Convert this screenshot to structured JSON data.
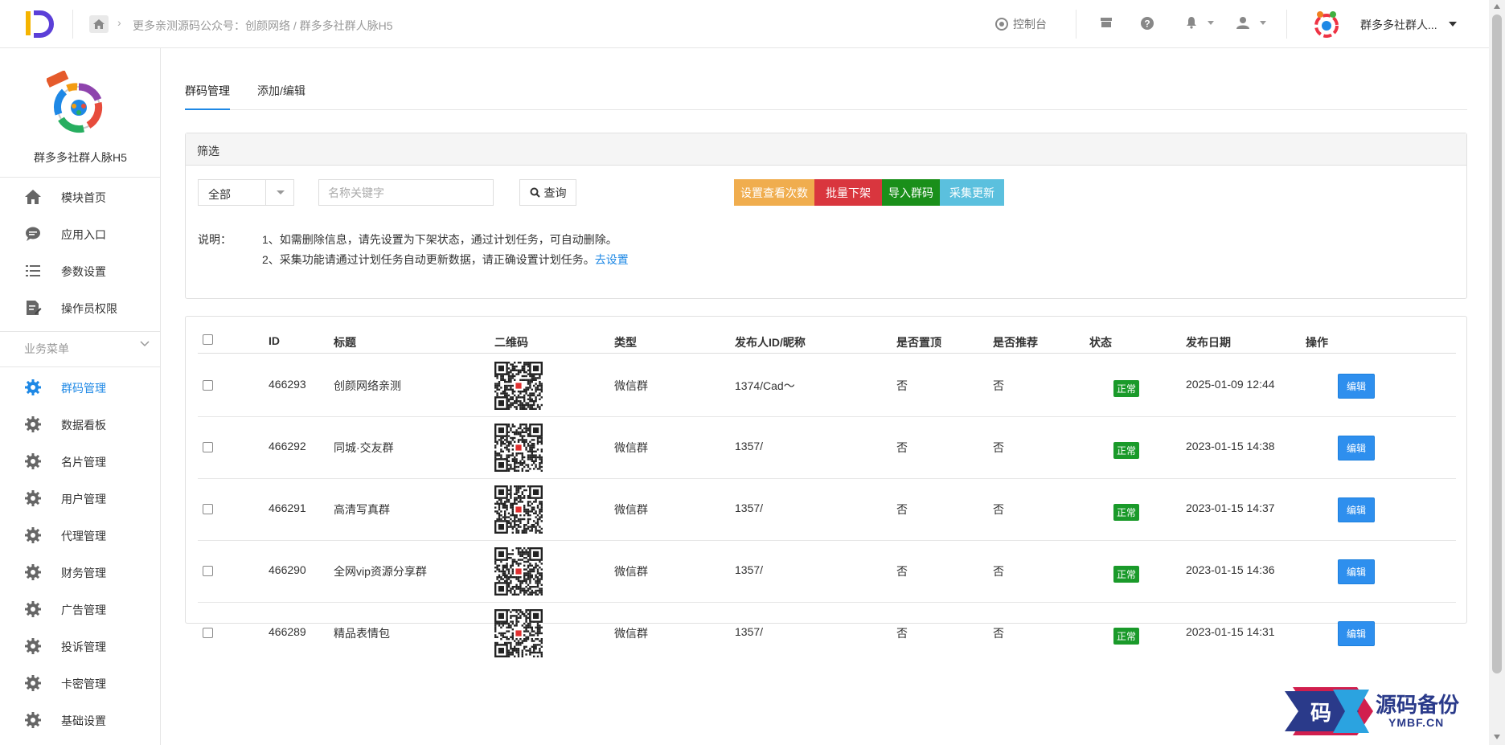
{
  "topbar": {
    "breadcrumb": "更多亲测源码公众号：创颜网络 / 群多多社群人脉H5",
    "console_label": "控制台",
    "user_name": "群多多社群人..."
  },
  "sidebar": {
    "brand_name": "群多多社群人脉H5",
    "items": [
      {
        "label": "模块首页",
        "icon": "home-icon"
      },
      {
        "label": "应用入口",
        "icon": "chat-icon"
      },
      {
        "label": "参数设置",
        "icon": "list-icon"
      },
      {
        "label": "操作员权限",
        "icon": "edit-doc-icon"
      }
    ],
    "section_label": "业务菜单",
    "biz_items": [
      {
        "label": "群码管理",
        "active": true
      },
      {
        "label": "数据看板"
      },
      {
        "label": "名片管理"
      },
      {
        "label": "用户管理"
      },
      {
        "label": "代理管理"
      },
      {
        "label": "财务管理"
      },
      {
        "label": "广告管理"
      },
      {
        "label": "投诉管理"
      },
      {
        "label": "卡密管理"
      },
      {
        "label": "基础设置"
      }
    ]
  },
  "tabs": [
    "群码管理",
    "添加/编辑"
  ],
  "filter": {
    "title": "筛选",
    "select_value": "全部",
    "search_placeholder": "名称关键字",
    "query_label": "查询",
    "buttons": [
      {
        "label": "设置查看次数",
        "color": "#f0ad4e"
      },
      {
        "label": "批量下架",
        "color": "#d9363e"
      },
      {
        "label": "导入群码",
        "color": "#1a8f1a"
      },
      {
        "label": "采集更新",
        "color": "#5bc0de"
      }
    ],
    "note_label": "说明：",
    "note_1": "1、如需删除信息，请先设置为下架状态，通过计划任务，可自动删除。",
    "note_2": "2、采集功能请通过计划任务自动更新数据，请正确设置计划任务。",
    "note_link": "去设置"
  },
  "table": {
    "headers": [
      "ID",
      "标题",
      "二维码",
      "类型",
      "发布人ID/昵称",
      "是否置顶",
      "是否推荐",
      "状态",
      "发布日期",
      "操作"
    ],
    "rows": [
      {
        "id": "466293",
        "title": "创颜网络亲测",
        "type": "微信群",
        "publisher": "1374/Cad～",
        "top": "否",
        "recommend": "否",
        "status": "正常",
        "date": "2025-01-09 12:44",
        "action": "编辑"
      },
      {
        "id": "466292",
        "title": "同城·交友群",
        "type": "微信群",
        "publisher": "1357/",
        "top": "否",
        "recommend": "否",
        "status": "正常",
        "date": "2023-01-15 14:38",
        "action": "编辑"
      },
      {
        "id": "466291",
        "title": "高清写真群",
        "type": "微信群",
        "publisher": "1357/",
        "top": "否",
        "recommend": "否",
        "status": "正常",
        "date": "2023-01-15 14:37",
        "action": "编辑"
      },
      {
        "id": "466290",
        "title": "全网vip资源分享群",
        "type": "微信群",
        "publisher": "1357/",
        "top": "否",
        "recommend": "否",
        "status": "正常",
        "date": "2023-01-15 14:36",
        "action": "编辑"
      },
      {
        "id": "466289",
        "title": "精品表情包",
        "type": "微信群",
        "publisher": "1357/",
        "top": "否",
        "recommend": "否",
        "status": "正常",
        "date": "2023-01-15 14:31",
        "action": "编辑"
      }
    ]
  },
  "watermark": {
    "text": "源码备份",
    "sub": "YMBF.CN"
  }
}
